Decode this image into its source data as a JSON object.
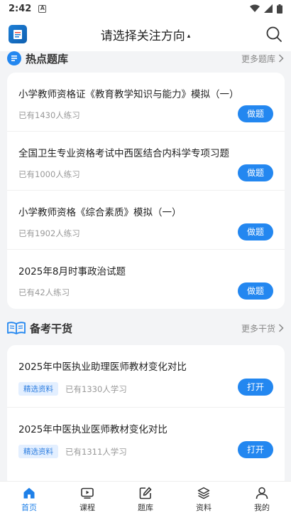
{
  "status_bar": {
    "time": "2:42"
  },
  "header": {
    "title": "请选择关注方向",
    "arrow": "▴"
  },
  "hot_questions": {
    "title": "热点题库",
    "more": "更多题库",
    "items": [
      {
        "title": "小学教师资格证《教育教学知识与能力》模拟（一）",
        "sub": "已有1430人练习",
        "action": "做题"
      },
      {
        "title": "全国卫生专业资格考试中西医结合内科学专项习题",
        "sub": "已有1000人练习",
        "action": "做题"
      },
      {
        "title": "小学教师资格《综合素质》模拟（一）",
        "sub": "已有1902人练习",
        "action": "做题"
      },
      {
        "title": "2025年8月时事政治试题",
        "sub": "已有42人练习",
        "action": "做题"
      }
    ]
  },
  "study_materials": {
    "title": "备考干货",
    "more": "更多干货",
    "items": [
      {
        "title": "2025年中医执业助理医师教材变化对比",
        "tag": "精选资料",
        "sub": "已有1330人学习",
        "action": "打开"
      },
      {
        "title": "2025年中医执业医师教材变化对比",
        "tag": "精选资料",
        "sub": "已有1311人学习",
        "action": "打开"
      }
    ]
  },
  "tabbar": {
    "items": [
      {
        "label": "首页",
        "icon": "home-icon"
      },
      {
        "label": "课程",
        "icon": "play-icon"
      },
      {
        "label": "题库",
        "icon": "edit-icon"
      },
      {
        "label": "资料",
        "icon": "layers-icon"
      },
      {
        "label": "我的",
        "icon": "user-icon"
      }
    ]
  },
  "colors": {
    "accent": "#2387f0",
    "tag_bg": "#e3efff",
    "background": "#f3f4f6"
  }
}
